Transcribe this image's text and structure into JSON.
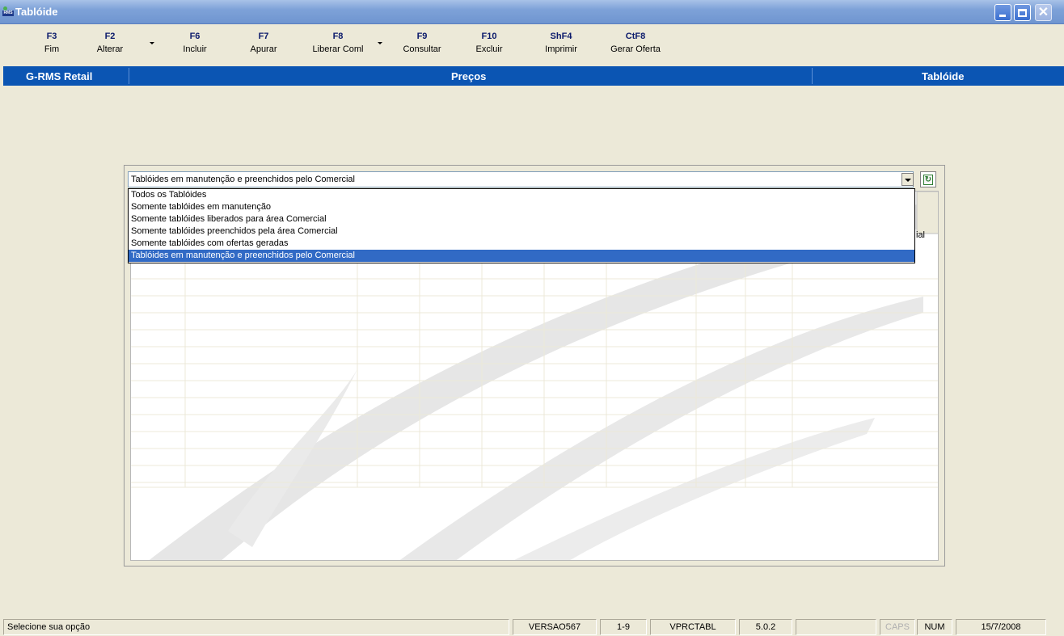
{
  "window": {
    "title": "Tablóide",
    "app_badge": "RMS"
  },
  "toolbar": {
    "buttons": [
      {
        "key": "F3",
        "label": "Fim"
      },
      {
        "key": "F2",
        "label": "Alterar"
      },
      {
        "key": "F6",
        "label": "Incluir"
      },
      {
        "key": "F7",
        "label": "Apurar"
      },
      {
        "key": "F8",
        "label": "Liberar Coml"
      },
      {
        "key": "F9",
        "label": "Consultar"
      },
      {
        "key": "F10",
        "label": "Excluir"
      },
      {
        "key": "ShF4",
        "label": "Imprimir"
      },
      {
        "key": "CtF8",
        "label": "Gerar Oferta"
      }
    ]
  },
  "section": {
    "left": "G-RMS Retail",
    "center": "Preços",
    "right": "Tablóide"
  },
  "filter": {
    "selected": "Tablóides em manutenção e preenchidos pelo Comercial",
    "options": [
      "Todos os Tablóides",
      "Somente tablóides em manutenção",
      "Somente tablóides liberados para área Comercial",
      "Somente tablóides preenchidos pela área Comercial",
      "Somente tablóides com ofertas geradas",
      "Tablóides em manutenção e preenchidos pelo Comercial"
    ]
  },
  "grid": {
    "partial_header": "ial"
  },
  "status": {
    "message": "Selecione sua opção",
    "version": "VERSAO567",
    "range": "1-9",
    "program": "VPRCTABL",
    "release": "5.0.2",
    "caps": "CAPS",
    "num": "NUM",
    "date": "15/7/2008"
  },
  "colors": {
    "section_bar": "#0b55b3",
    "selection": "#316ac5",
    "title_bar": "#7ea2d8"
  }
}
